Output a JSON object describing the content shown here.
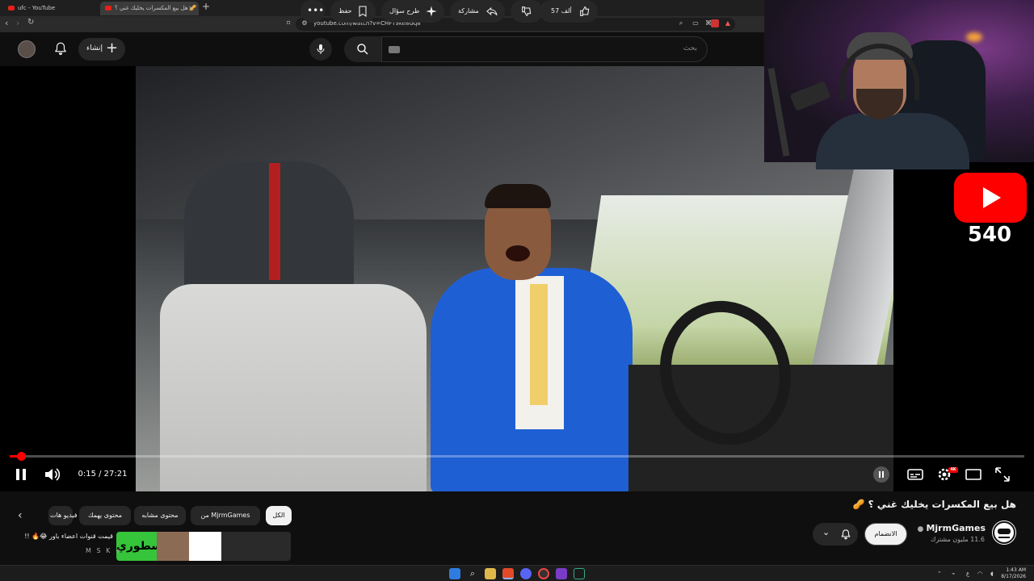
{
  "browser": {
    "tabs": [
      {
        "label": "ufc - YouTube"
      },
      {
        "label": "هل بيع المكسرات يخليك غني ؟ 🥜 -"
      }
    ],
    "url": "youtube.com/watch?v=CHFT9ke8Gq8"
  },
  "header": {
    "create_label": "إنشاء",
    "search_placeholder": "بحث"
  },
  "overlay": {
    "sub_count": "540"
  },
  "player": {
    "time": "0:15 / 27:21",
    "progress_fraction": 0.009
  },
  "video": {
    "title": "هل بيع المكسرات يخليك غني ؟ 🥜",
    "channel_name": "MjrmGames",
    "channel_subs": "11.6 مليون مشترك",
    "join_label": "الانضمام",
    "like_count": "57 ألف",
    "share_label": "مشاركة",
    "ask_label": "طرح سؤال",
    "save_label": "حفظ"
  },
  "chips": {
    "all": "الكل",
    "from_channel": "من MjrmGames",
    "similar": "محتوى مشابه",
    "interest": "محتوى يهمك",
    "videos": "فيديو هات"
  },
  "related": {
    "title": "قيمت قنوات اعضاء باور 😂🔥 !!",
    "subtitle": "M S K +",
    "thumb_text": "اسطوري"
  },
  "taskbar": {
    "time": "1:43 AM",
    "date": "8/17/2026",
    "lang": "ع"
  },
  "colors": {
    "accent": "#ff0000",
    "background": "#0f0f0f",
    "pill": "#272727"
  }
}
